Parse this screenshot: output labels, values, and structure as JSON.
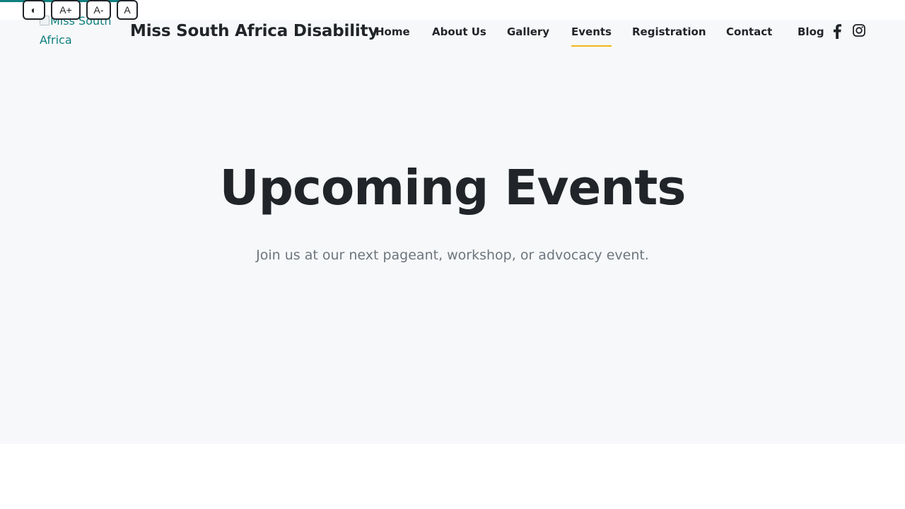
{
  "accessibility": {
    "contrast_label": "◐",
    "increase_label": "A+",
    "decrease_label": "A-",
    "reset_label": "A"
  },
  "header": {
    "logo_alt": "Miss South Africa",
    "brand": "Miss South Africa Disability",
    "nav": [
      {
        "label": "Home",
        "active": false
      },
      {
        "label": "About Us",
        "active": false
      },
      {
        "label": "Gallery",
        "active": false
      },
      {
        "label": "Events",
        "active": true
      },
      {
        "label": "Registration",
        "active": false
      },
      {
        "label": "Contact",
        "active": false
      },
      {
        "label": "Blog",
        "active": false
      }
    ],
    "social": [
      "facebook-icon",
      "instagram-icon"
    ]
  },
  "hero": {
    "title": "Upcoming Events",
    "subtitle": "Join us at our next pageant, workshop, or advocacy event."
  },
  "colors": {
    "accent": "#0f7f7f",
    "active_underline": "#f4b41a",
    "hero_bg": "#f7f8fa",
    "text": "#212529",
    "muted": "#6c757d"
  }
}
